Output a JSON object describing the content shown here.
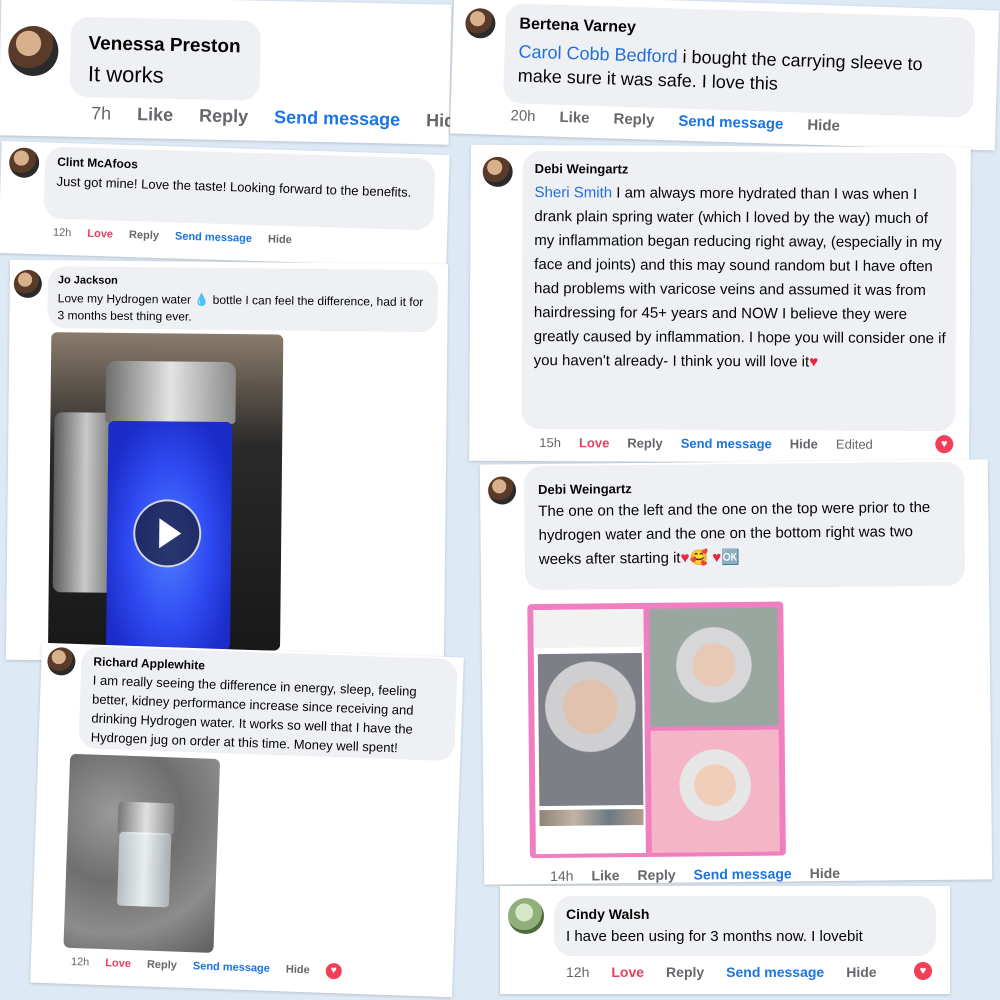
{
  "comments": [
    {
      "id": "venessa",
      "author": "Venessa Preston",
      "text": "It works",
      "time": "7h",
      "actions": [
        "Like",
        "Reply",
        "Send message",
        "Hide"
      ]
    },
    {
      "id": "bertena",
      "author": "Bertena Varney",
      "mention": "Carol Cobb Bedford",
      "text": " i bought the carrying sleeve to make sure it was safe. I love this",
      "time": "20h",
      "actions": [
        "Like",
        "Reply",
        "Send message",
        "Hide"
      ]
    },
    {
      "id": "clint",
      "author": "Clint McAfoos",
      "text": "Just got mine! Love the taste! Looking forward to the benefits.",
      "time": "12h",
      "actions": [
        "Love",
        "Reply",
        "Send message",
        "Hide"
      ]
    },
    {
      "id": "jo",
      "author": "Jo Jackson",
      "text_parts": [
        "Love my Hydrogen water ",
        "💧",
        " bottle I can feel the difference, had it for 3 months best thing ever."
      ],
      "media": "video"
    },
    {
      "id": "debi1",
      "author": "Debi Weingartz",
      "mention": "Sheri Smith",
      "text": " I am always more hydrated than I was when I drank plain spring water (which I loved by the way) much of my inflammation began reducing right away, (especially in my face and joints) and this may sound random but I have often had problems with varicose veins and assumed it was from hairdressing for 45+ years and NOW I believe they were greatly caused by inflammation. I hope you will consider one if you haven't already- I think you will love it",
      "heart_symbol": "♥",
      "time": "15h",
      "actions": [
        "Love",
        "Reply",
        "Send message",
        "Hide",
        "Edited"
      ]
    },
    {
      "id": "debi2",
      "author": "Debi Weingartz",
      "text": "The one on the left and the one on the top were prior to the hydrogen water and the one on the bottom right was two weeks after starting it",
      "emoji": "♥🥰 ♥🆗",
      "time": "14h",
      "actions": [
        "Like",
        "Reply",
        "Send message",
        "Hide"
      ]
    },
    {
      "id": "richard",
      "author": "Richard Applewhite",
      "text": "I am really seeing the difference in energy, sleep, feeling better, kidney performance increase since receiving and drinking Hydrogen water. It works so well that I have the Hydrogen jug on order at this time. Money well spent!",
      "time": "12h",
      "actions": [
        "Love",
        "Reply",
        "Send message",
        "Hide"
      ]
    },
    {
      "id": "cindy",
      "author": "Cindy Walsh",
      "text": "I have been using for 3 months now. I lovebit",
      "time": "12h",
      "actions": [
        "Love",
        "Reply",
        "Send message",
        "Hide"
      ]
    }
  ],
  "heart_icon": "heart-reaction-icon",
  "play_icon": "play-icon",
  "colors": {
    "background": "#dde9f4",
    "bubble": "#eef0f3",
    "link": "#216fdb",
    "send_message": "#1b74e4",
    "love": "#e4405f"
  }
}
